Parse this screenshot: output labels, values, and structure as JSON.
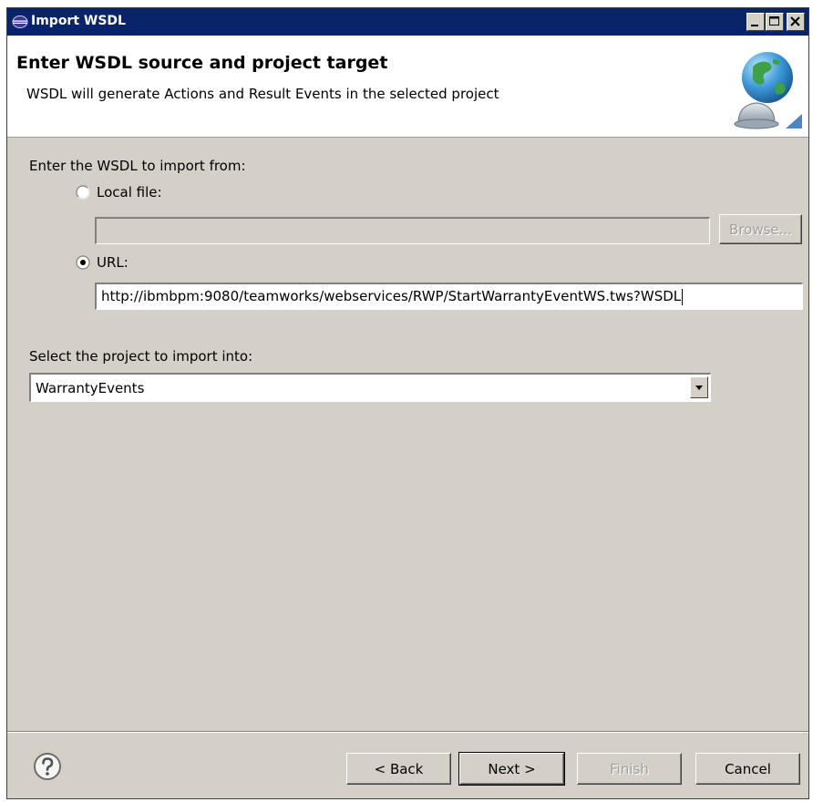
{
  "window": {
    "title": "Import WSDL",
    "icon": "eclipse-icon"
  },
  "banner": {
    "title": "Enter WSDL source and project target",
    "description": "WSDL will generate Actions and Result Events in the selected project",
    "image": "globe-wizard-icon"
  },
  "source": {
    "prompt": "Enter the WSDL to import from:",
    "local_file_label": "Local file:",
    "local_file_value": "",
    "local_file_selected": false,
    "browse_label": "Browse...",
    "url_label": "URL:",
    "url_value": "http://ibmbpm:9080/teamworks/webservices/RWP/StartWarrantyEventWS.tws?WSDL",
    "url_selected": true
  },
  "project": {
    "prompt": "Select the project to import into:",
    "selected": "WarrantyEvents"
  },
  "footer": {
    "help_icon": "help-icon",
    "back_label": "< Back",
    "next_label": "Next >",
    "finish_label": "Finish",
    "cancel_label": "Cancel"
  },
  "colors": {
    "titlebar": "#0a246a",
    "dialog_bg": "#d4d0c8",
    "banner_bg": "#ffffff"
  }
}
